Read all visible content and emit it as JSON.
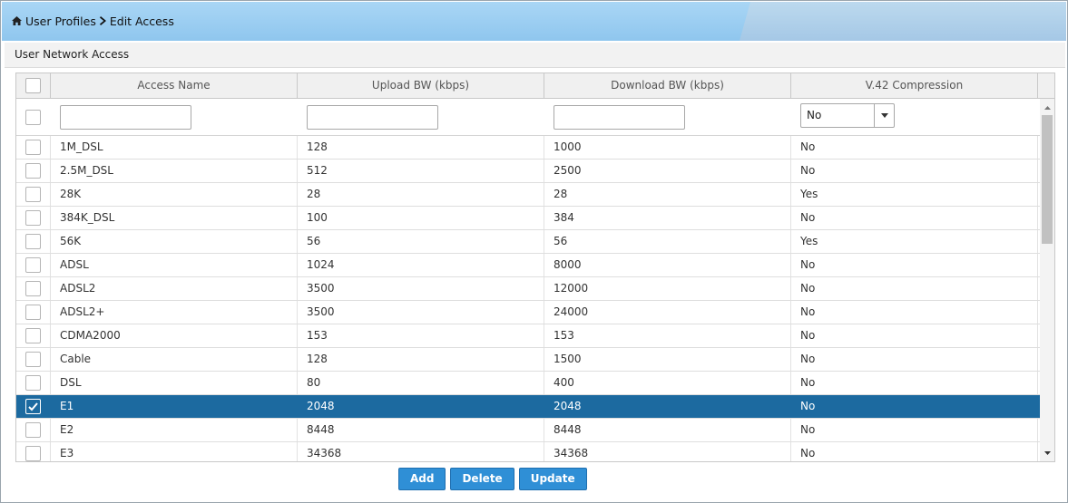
{
  "breadcrumb": {
    "home_icon": "home-icon",
    "items": [
      "User Profiles",
      "Edit Access"
    ],
    "separator_icon": "chevron-right-icon"
  },
  "section": {
    "title": "User Network Access"
  },
  "grid": {
    "columns": [
      "Access Name",
      "Upload BW (kbps)",
      "Download BW (kbps)",
      "V.42 Compression"
    ],
    "filters": {
      "name": "",
      "upload": "",
      "download": "",
      "v42_selected": "No"
    },
    "rows": [
      {
        "name": "1M_DSL",
        "upload": "128",
        "download": "1000",
        "v42": "No",
        "checked": false
      },
      {
        "name": "2.5M_DSL",
        "upload": "512",
        "download": "2500",
        "v42": "No",
        "checked": false
      },
      {
        "name": "28K",
        "upload": "28",
        "download": "28",
        "v42": "Yes",
        "checked": false
      },
      {
        "name": "384K_DSL",
        "upload": "100",
        "download": "384",
        "v42": "No",
        "checked": false
      },
      {
        "name": "56K",
        "upload": "56",
        "download": "56",
        "v42": "Yes",
        "checked": false
      },
      {
        "name": "ADSL",
        "upload": "1024",
        "download": "8000",
        "v42": "No",
        "checked": false
      },
      {
        "name": "ADSL2",
        "upload": "3500",
        "download": "12000",
        "v42": "No",
        "checked": false
      },
      {
        "name": "ADSL2+",
        "upload": "3500",
        "download": "24000",
        "v42": "No",
        "checked": false
      },
      {
        "name": "CDMA2000",
        "upload": "153",
        "download": "153",
        "v42": "No",
        "checked": false
      },
      {
        "name": "Cable",
        "upload": "128",
        "download": "1500",
        "v42": "No",
        "checked": false
      },
      {
        "name": "DSL",
        "upload": "80",
        "download": "400",
        "v42": "No",
        "checked": false
      },
      {
        "name": "E1",
        "upload": "2048",
        "download": "2048",
        "v42": "No",
        "checked": true
      },
      {
        "name": "E2",
        "upload": "8448",
        "download": "8448",
        "v42": "No",
        "checked": false
      },
      {
        "name": "E3",
        "upload": "34368",
        "download": "34368",
        "v42": "No",
        "checked": false
      }
    ]
  },
  "buttons": {
    "add": "Add",
    "delete": "Delete",
    "update": "Update"
  },
  "colors": {
    "title_bar": "#8fc6ee",
    "selected_row": "#1c6aa0",
    "button": "#2f8fd6"
  }
}
